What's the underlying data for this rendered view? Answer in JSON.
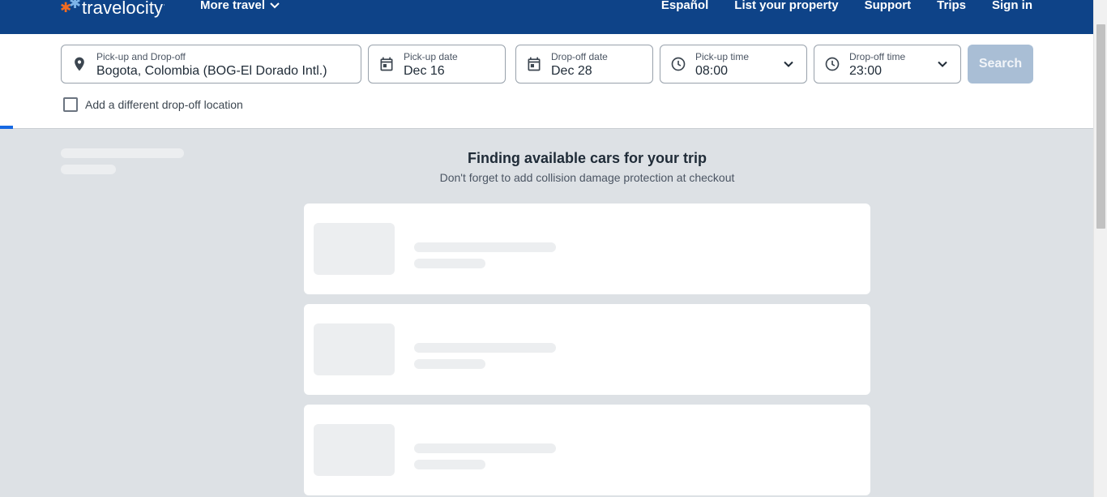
{
  "header": {
    "logo_text": "travelocity",
    "logo_trademark": "·",
    "more_travel": "More travel",
    "nav": [
      "Español",
      "List your property",
      "Support",
      "Trips",
      "Sign in"
    ]
  },
  "search": {
    "location": {
      "label": "Pick-up and Drop-off",
      "value": "Bogota, Colombia (BOG-El Dorado Intl.)",
      "icon": "location-pin-icon"
    },
    "pickup_date": {
      "label": "Pick-up date",
      "value": "Dec 16",
      "icon": "calendar-icon"
    },
    "dropoff_date": {
      "label": "Drop-off date",
      "value": "Dec 28",
      "icon": "calendar-icon"
    },
    "pickup_time": {
      "label": "Pick-up time",
      "value": "08:00",
      "icon": "clock-icon"
    },
    "dropoff_time": {
      "label": "Drop-off time",
      "value": "23:00",
      "icon": "clock-icon"
    },
    "button": "Search",
    "different_dropoff": "Add a different drop-off location",
    "different_dropoff_checked": false
  },
  "main": {
    "heading": "Finding available cars for your trip",
    "subheading": "Don't forget to add collision damage protection at checkout"
  },
  "colors": {
    "header_bg": "#0e4388",
    "search_button_disabled": "#a9bed5",
    "page_bg": "#dde1e5",
    "progress": "#1668e3"
  }
}
